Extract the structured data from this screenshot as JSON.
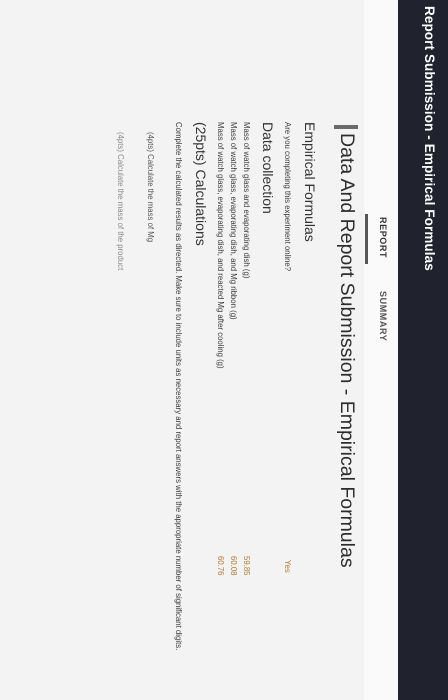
{
  "app": {
    "title": "Report Submission - Empirical Formulas"
  },
  "tabs": {
    "report": "REPORT",
    "summary": "SUMMARY"
  },
  "main": {
    "title": "Data And Report Submission - Empirical Formulas",
    "empirical": {
      "heading": "Empirical Formulas",
      "question": "Are you completing this experiment online?",
      "answer": "Yes"
    },
    "data_collection": {
      "heading": "Data collection",
      "rows": [
        {
          "label": "Mass of watch glass and evaporating dish (g)",
          "value": "59.85"
        },
        {
          "label": "Mass of watch glass, evaporating dish, and Mg ribbon (g)",
          "value": "60.08"
        },
        {
          "label": "Mass of watch glass, evaporating dish, and reacted Mg after cooling (g)",
          "value": "60.76"
        }
      ]
    },
    "calculations": {
      "heading": "(25pts) Calculations",
      "instructions": "Complete the calculated results as directed. Make sure to include units as necessary and report answers with the appropriate number of significant digits.",
      "items": [
        "(4pts)  Calculate the mass of Mg",
        "(4pts)  Calculate the mass of the product"
      ]
    }
  },
  "corner": {
    "icon": "expand-icon",
    "glyph": "^ ⊡"
  }
}
